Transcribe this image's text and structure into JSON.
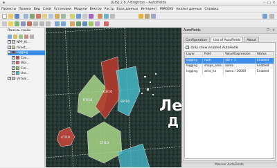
{
  "window": {
    "title": "[GIS] 2.6.7-Brighton - AutoFields"
  },
  "menu": [
    "Проекты",
    "Правка",
    "Вид",
    "Слой",
    "Установки",
    "Модули",
    "Вектор",
    "Растр",
    "База данных",
    "Интернет",
    "MMQGIS",
    "Анализ данных",
    "Справка"
  ],
  "layers_panel": {
    "title": "Панель слоёв",
    "layers": [
      {
        "label": "NPP_Ki...",
        "checked": true,
        "color": "#cfcfcf"
      },
      {
        "label": "forest_...",
        "checked": true,
        "color": "#d9d2b5"
      },
      {
        "label": "logging",
        "checked": true,
        "color": "#7a3b3b",
        "selected": true
      },
      {
        "label": "Con...",
        "checked": true,
        "color": "#c94a3a"
      },
      {
        "label": "Wol...",
        "checked": true,
        "color": "#e07070"
      },
      {
        "label": "Cre...",
        "checked": true,
        "color": "#8fc56d"
      },
      {
        "label": "Unr...",
        "checked": true,
        "color": "#46b5c4"
      },
      {
        "label": "Virtual...",
        "checked": true,
        "color": "#cccccc"
      }
    ]
  },
  "map": {
    "labels": [
      "67/10",
      "63/10",
      "82/10",
      "57/10",
      "47/10"
    ],
    "big_text": [
      "Ле",
      "Д"
    ]
  },
  "autofields": {
    "title": "AutoFields",
    "tabs": [
      "Configuration",
      "List of AutoFields",
      "About"
    ],
    "active_tab": "List of AutoFields",
    "show_enabled_label": "Only show enabled AutoFields",
    "show_enabled_checked": true,
    "columns": [
      "Layer",
      "Field",
      "Value/Expression",
      "Status"
    ],
    "rows": [
      {
        "layer": "logging",
        "field": "num",
        "value": "$id + 1",
        "status": "Enabled",
        "selected": true
      },
      {
        "layer": "logging",
        "field": "shape_area",
        "value": "$area",
        "status": "Enabled"
      },
      {
        "layer": "logging",
        "field": "area_ha",
        "value": "$area / 10000",
        "status": "Enabled"
      }
    ],
    "footer": "Mansar AutoFields"
  },
  "colors": {
    "selection": "#3c8ee6",
    "map_bg": "#22302c",
    "polygon_red": "#b23a2c",
    "polygon_green": "#a9d688",
    "polygon_cyan": "#45b7c5"
  }
}
